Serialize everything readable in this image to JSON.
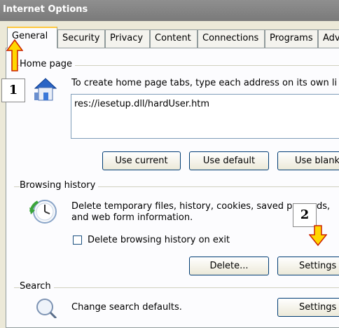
{
  "window": {
    "title": "Internet Options"
  },
  "tabs": [
    "General",
    "Security",
    "Privacy",
    "Content",
    "Connections",
    "Programs",
    "Adv"
  ],
  "home_page": {
    "group_label": "Home page",
    "description": "To create home page tabs, type each address on its own li",
    "url": "res://iesetup.dll/hardUser.htm",
    "buttons": {
      "use_current": "Use current",
      "use_default": "Use default",
      "use_blank": "Use blank"
    }
  },
  "browsing_history": {
    "group_label": "Browsing history",
    "description_line1": "Delete temporary files, history, cookies, saved p",
    "description_line1_tail": "ds,",
    "description_line2": "and web form information.",
    "checkbox_label": "Delete browsing history on exit",
    "buttons": {
      "delete": "Delete...",
      "settings": "Settings"
    }
  },
  "search": {
    "group_label": "Search",
    "description": "Change search defaults.",
    "buttons": {
      "settings": "Settings"
    }
  },
  "annotations": {
    "badge1": "1",
    "badge2": "2",
    "arrow_color": "#ffd700",
    "arrow_outline": "#cc2200"
  },
  "icons": {
    "home": "home-icon",
    "history": "history-clock-icon",
    "search": "search-magnifier-icon"
  }
}
